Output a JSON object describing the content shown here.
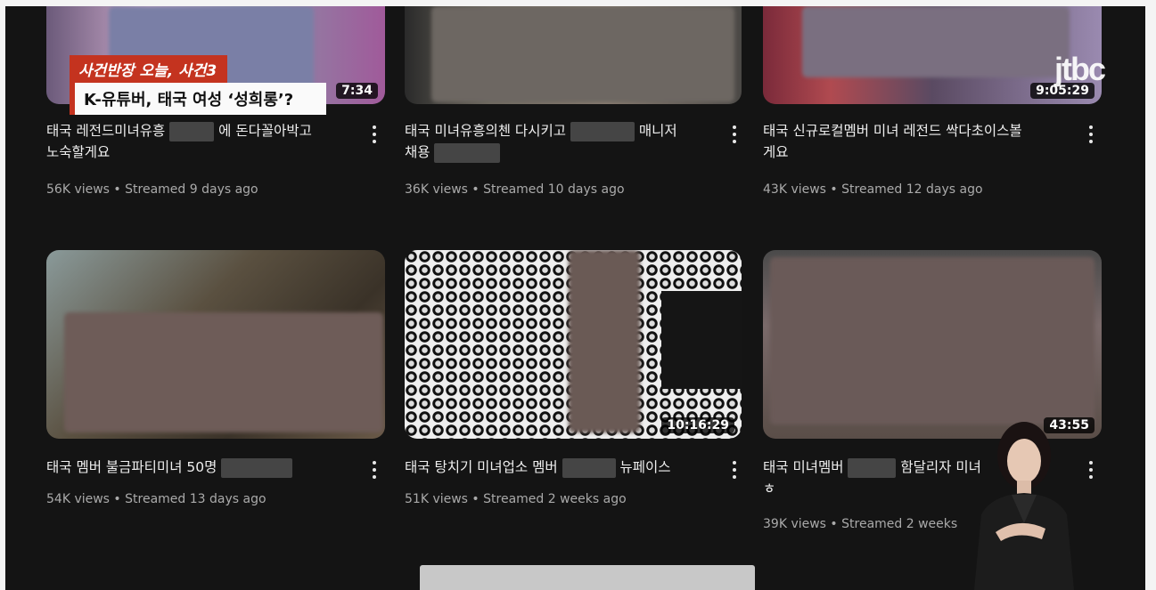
{
  "broadcast": {
    "caption_line1": "사건반장 오늘, 사건3",
    "caption_line2": "K-유튜버, 태국 여성 ‘성희롱’?",
    "logo_text": "jtbc"
  },
  "videos": [
    {
      "title_a": "태국 레전드미녀유흥",
      "title_b": "에 돈다꼴아박고",
      "title_c": "노숙할게요",
      "meta": "56K views • Streamed 9 days ago",
      "duration": "7:34"
    },
    {
      "title_a": "태국 미녀유흥의첸 다시키고",
      "title_b": "매니저",
      "title_c": "채용",
      "meta": "36K views • Streamed 10 days ago",
      "duration": ""
    },
    {
      "title_a": "태국 신규로컬멤버 미녀 레전드 싹다초이스볼",
      "title_b": "",
      "title_c": "게요",
      "meta": "43K views • Streamed 12 days ago",
      "duration": "9:05:29"
    },
    {
      "title_a": "태국 멤버 불금파티미녀 50명",
      "title_b": "",
      "title_c": "",
      "meta": "54K views • Streamed 13 days ago",
      "duration": ""
    },
    {
      "title_a": "태국 탕치기 미녀업소 멤버",
      "title_b": "뉴페이스",
      "title_c": "",
      "meta": "51K views • Streamed 2 weeks ago",
      "duration": "10:16:29"
    },
    {
      "title_a": "태국 미녀멤버",
      "title_b": "함달리자 미녀",
      "title_c": "ㅎ",
      "meta": "39K views • Streamed 2 weeks",
      "duration": "43:55"
    }
  ],
  "colors": {
    "background": "#141414",
    "caption_red": "#c4331f",
    "meta_gray": "#aaaaaa"
  }
}
